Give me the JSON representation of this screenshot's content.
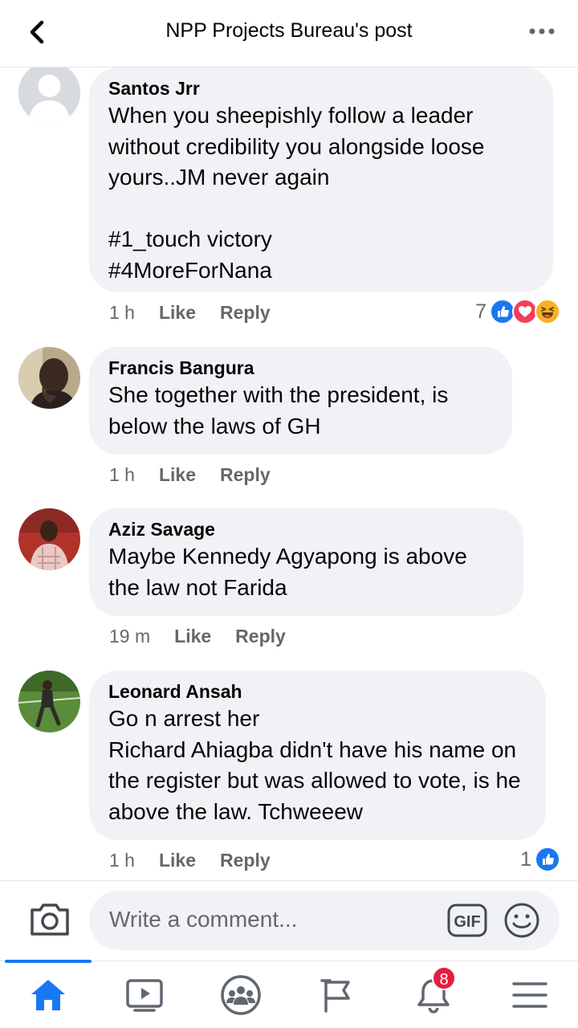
{
  "header": {
    "title": "NPP Projects Bureau's post",
    "back_icon": "chevron-left-icon",
    "more_icon": "more-horizontal-icon"
  },
  "comments": [
    {
      "author": "Santos Jrr",
      "text": "When you sheepishly follow a leader without credibility you alongside loose yours..JM never again\n\n#1_touch victory\n#4MoreForNana",
      "time": "1 h",
      "like_label": "Like",
      "reply_label": "Reply",
      "reaction_count": "7",
      "reactions": [
        "like",
        "love",
        "haha"
      ]
    },
    {
      "author": "Francis Bangura",
      "text": "She together with the president, is below the laws of GH",
      "time": "1 h",
      "like_label": "Like",
      "reply_label": "Reply"
    },
    {
      "author": "Aziz Savage",
      "text": "Maybe Kennedy Agyapong is above the law not Farida",
      "time": "19 m",
      "like_label": "Like",
      "reply_label": "Reply"
    },
    {
      "author": "Leonard Ansah",
      "text": "Go n arrest her\nRichard Ahiagba didn't have his name on the register but was allowed to vote, is he above the law. Tchweeew",
      "time": "1 h",
      "like_label": "Like",
      "reply_label": "Reply",
      "reaction_count": "1",
      "reactions": [
        "like"
      ]
    }
  ],
  "composer": {
    "placeholder": "Write a comment...",
    "gif_label": "GIF"
  },
  "tabbar": {
    "active": "home",
    "notifications_badge": "8"
  },
  "colors": {
    "accent": "#1877f2",
    "bubble": "#f0f2f5",
    "secondary_text": "#65676b",
    "love": "#f33e58",
    "haha": "#f7b125",
    "badge": "#e41e3f"
  }
}
